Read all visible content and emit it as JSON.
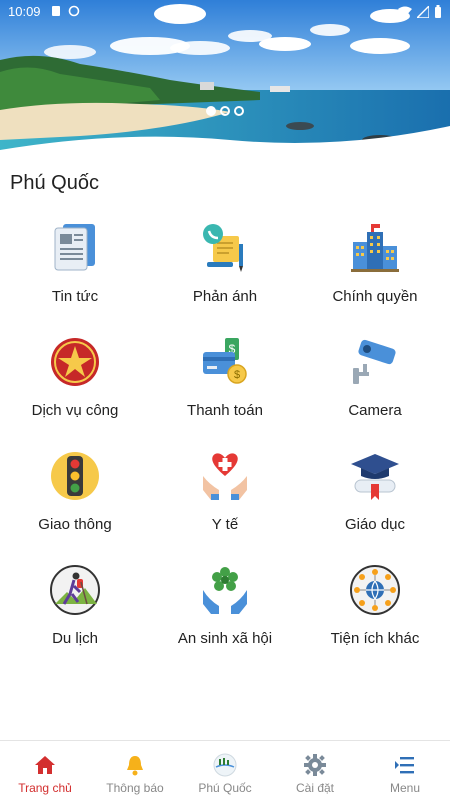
{
  "status_bar": {
    "time": "10:09"
  },
  "banner": {
    "slide_count": 3,
    "active_slide": 1
  },
  "page": {
    "title": "Phú Quốc"
  },
  "tiles": [
    {
      "label": "Tin tức",
      "icon": "newspaper-icon"
    },
    {
      "label": "Phản ánh",
      "icon": "feedback-icon"
    },
    {
      "label": "Chính quyền",
      "icon": "government-building-icon"
    },
    {
      "label": "Dịch vụ công",
      "icon": "public-service-emblem-icon"
    },
    {
      "label": "Thanh toán",
      "icon": "payment-icon"
    },
    {
      "label": "Camera",
      "icon": "security-camera-icon"
    },
    {
      "label": "Giao thông",
      "icon": "traffic-light-icon"
    },
    {
      "label": "Y tế",
      "icon": "health-hands-icon"
    },
    {
      "label": "Giáo dục",
      "icon": "graduation-cap-icon"
    },
    {
      "label": "Du lịch",
      "icon": "hiker-icon"
    },
    {
      "label": "An sinh xã hội",
      "icon": "social-welfare-icon"
    },
    {
      "label": "Tiện ích khác",
      "icon": "globe-network-icon"
    }
  ],
  "bottom_nav": [
    {
      "label": "Trang chủ",
      "icon": "home-icon",
      "active": true
    },
    {
      "label": "Thông báo",
      "icon": "bell-icon",
      "active": false
    },
    {
      "label": "Phú Quốc",
      "icon": "city-logo-icon",
      "active": false
    },
    {
      "label": "Cài đặt",
      "icon": "gear-icon",
      "active": false
    },
    {
      "label": "Menu",
      "icon": "menu-icon",
      "active": false
    }
  ],
  "colors": {
    "accent": "#d32f2f",
    "nav_inactive": "#888888"
  }
}
